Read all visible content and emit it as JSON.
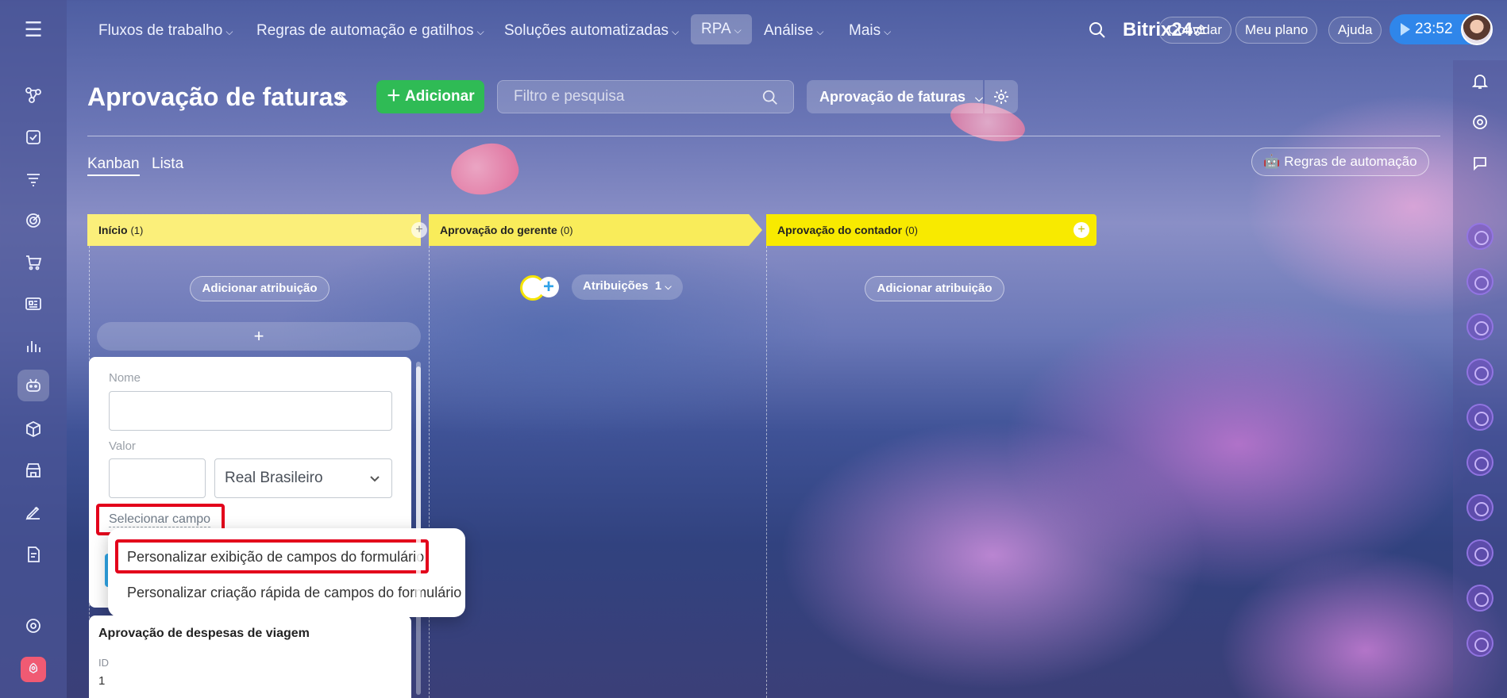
{
  "colors": {
    "add_button": "#2fbb55",
    "timer": "#2f86ea",
    "highlight": "#e3001b",
    "stage_inicio": "#fbef7a",
    "stage_gerente": "#f9ec5a",
    "stage_contador": "#f8ea00"
  },
  "topnav": {
    "items": [
      {
        "label": "Fluxos de trabalho"
      },
      {
        "label": "Regras de automação e gatilhos"
      },
      {
        "label": "Soluções automatizadas"
      },
      {
        "label": "RPA"
      },
      {
        "label": "Análise"
      },
      {
        "label": "Mais"
      }
    ],
    "brand": "Bitrix24",
    "invite": "Convidar",
    "my_plan": "Meu plano",
    "help": "Ajuda",
    "time": "23:52"
  },
  "page": {
    "title": "Aprovação de faturas",
    "add_label": "Adicionar",
    "filter_placeholder": "Filtro e pesquisa",
    "view_selector": "Aprovação de faturas",
    "tabs": [
      {
        "label": "Kanban"
      },
      {
        "label": "Lista"
      }
    ],
    "automation_rules": "Regras de automação"
  },
  "stages": [
    {
      "title": "Início",
      "count": "(1)",
      "assign_label": "Adicionar atribuição"
    },
    {
      "title": "Aprovação do gerente",
      "count": "(0)",
      "assignments_label": "Atribuições",
      "assignments_count": "1"
    },
    {
      "title": "Aprovação do contador",
      "count": "(0)",
      "assign_label": "Adicionar atribuição"
    }
  ],
  "quick_form": {
    "quick_add": "+",
    "name_label": "Nome",
    "name_value": "",
    "value_label": "Valor",
    "value_value": "",
    "currency": "Real Brasileiro",
    "select_field": "Selecionar campo"
  },
  "popup_menu": {
    "items": [
      {
        "label": "Personalizar exibição de campos do formulário"
      },
      {
        "label": "Personalizar criação rápida de campos do formulário"
      }
    ]
  },
  "card": {
    "title": "Aprovação de despesas de viagem",
    "id_label": "ID",
    "id_value": "1"
  }
}
